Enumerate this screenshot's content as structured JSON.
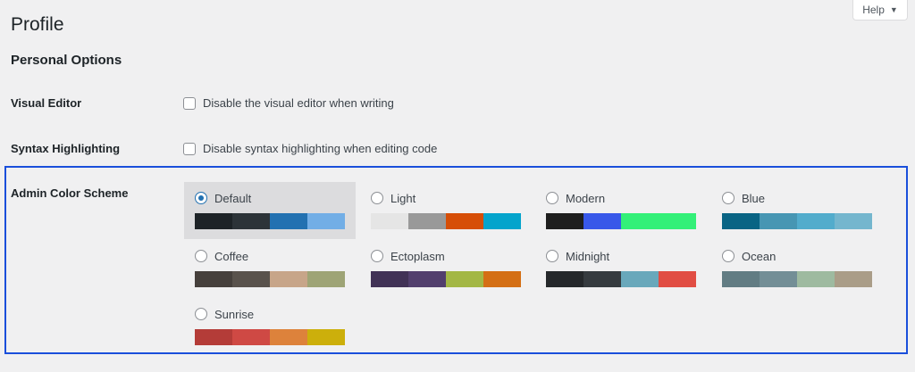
{
  "page": {
    "title": "Profile",
    "help_label": "Help"
  },
  "personal_options": {
    "title": "Personal Options",
    "visual_editor": {
      "label": "Visual Editor",
      "checkbox_text": "Disable the visual editor when writing",
      "checked": false
    },
    "syntax_highlighting": {
      "label": "Syntax Highlighting",
      "checkbox_text": "Disable syntax highlighting when editing code",
      "checked": false
    },
    "admin_color_scheme": {
      "label": "Admin Color Scheme",
      "selected": "Default",
      "schemes": [
        {
          "name": "Default",
          "colors": [
            "#1d2327",
            "#2c3338",
            "#2271b1",
            "#72aee6"
          ]
        },
        {
          "name": "Light",
          "colors": [
            "#e5e5e5",
            "#999999",
            "#d64e07",
            "#04a4cc"
          ]
        },
        {
          "name": "Modern",
          "colors": [
            "#1e1e1e",
            "#3858e9",
            "#33f078",
            "#33f078"
          ]
        },
        {
          "name": "Blue",
          "colors": [
            "#096484",
            "#4796b3",
            "#52accc",
            "#74b6ce"
          ]
        },
        {
          "name": "Coffee",
          "colors": [
            "#46403c",
            "#59524c",
            "#c7a589",
            "#9ea476"
          ]
        },
        {
          "name": "Ectoplasm",
          "colors": [
            "#413256",
            "#523f6d",
            "#a3b745",
            "#d46f15"
          ]
        },
        {
          "name": "Midnight",
          "colors": [
            "#25282b",
            "#363b3f",
            "#69a8bb",
            "#e14d43"
          ]
        },
        {
          "name": "Ocean",
          "colors": [
            "#627c83",
            "#738e96",
            "#9ebaa0",
            "#aa9d88"
          ]
        },
        {
          "name": "Sunrise",
          "colors": [
            "#b43c38",
            "#cf4944",
            "#dd823b",
            "#ccaf0b"
          ]
        }
      ]
    }
  },
  "colors": {
    "background": "#f0f0f1",
    "highlight_border": "#1a4fdb",
    "accent": "#2271b1"
  },
  "icons": {
    "help_caret": "caret-down-icon"
  }
}
